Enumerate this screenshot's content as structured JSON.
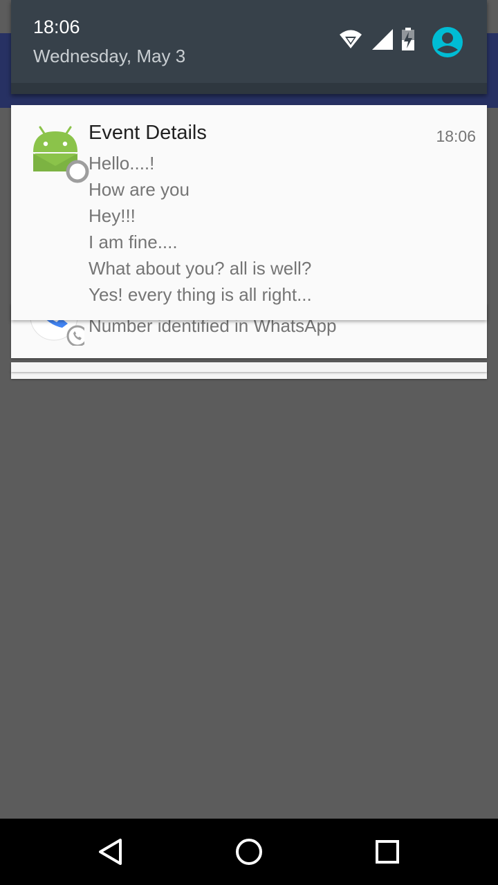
{
  "status_bar": {
    "time": "18:06",
    "date": "Wednesday, May 3",
    "icons": [
      "wifi-icon",
      "cell-signal-icon",
      "battery-charging-icon",
      "user-avatar-icon"
    ]
  },
  "colors": {
    "shade_header": "#37414a",
    "app_bar": "#273163",
    "scrim": "#5c5c5c",
    "card": "#fafafa",
    "android_green": "#8bc34a",
    "avatar_accent": "#00bcd4",
    "phone_blue": "#4285f4"
  },
  "notifications": [
    {
      "app_icon": "android-robot-icon",
      "title": "Event Details",
      "time": "18:06",
      "lines": [
        "Hello....!",
        "How are you",
        "Hey!!!",
        "I am fine....",
        "What about you? all is well?",
        "Yes! every thing is all right..."
      ]
    },
    {
      "app_icon": "whatsapp-caller-icon",
      "text": "Number identified in WhatsApp"
    }
  ],
  "nav_bar": {
    "buttons": [
      "back-icon",
      "home-icon",
      "recents-icon"
    ]
  }
}
